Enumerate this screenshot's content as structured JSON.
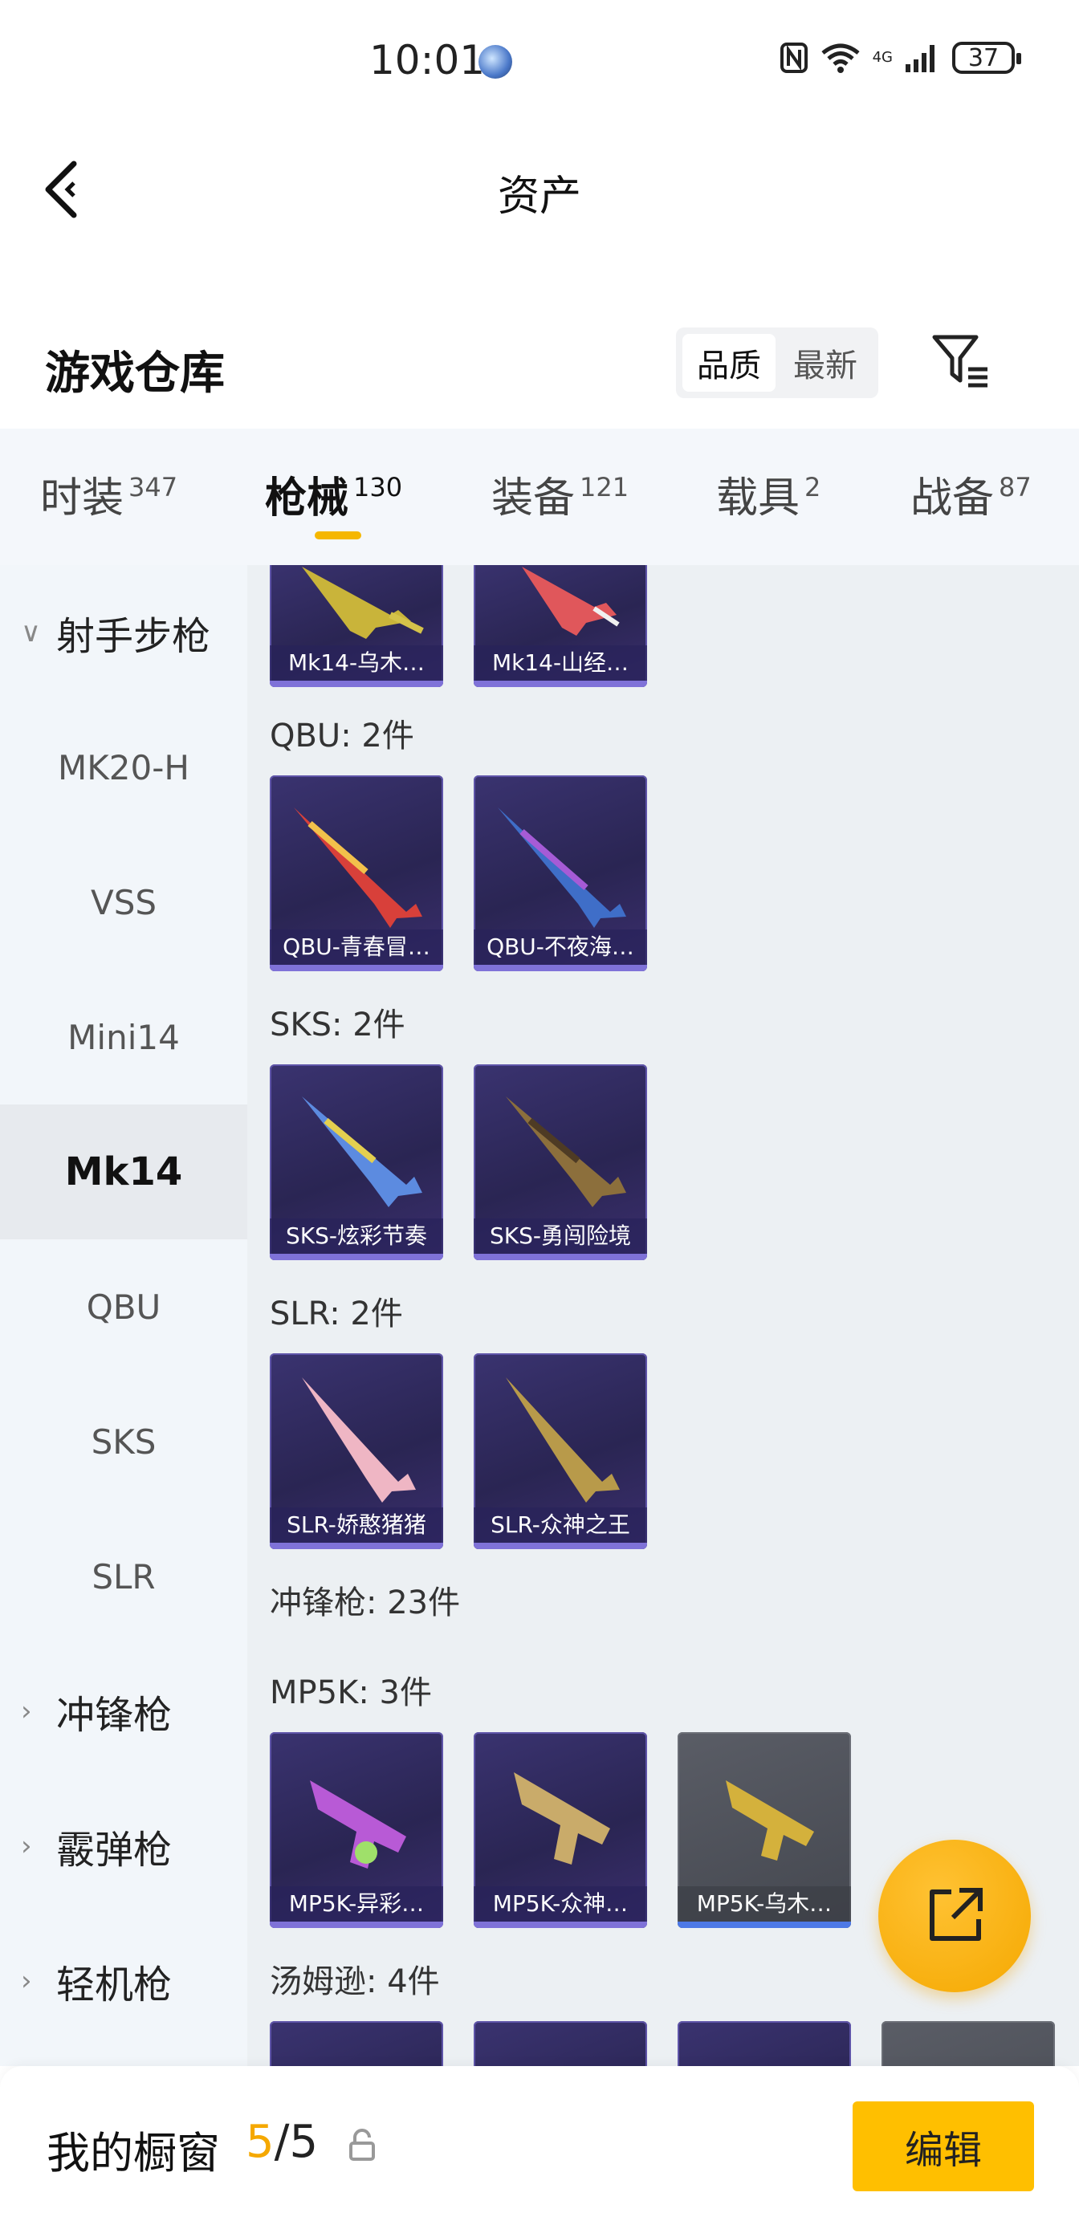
{
  "status_bar": {
    "time": "10:01",
    "network_label": "4G",
    "battery": "37"
  },
  "title_bar": {
    "title": "资产"
  },
  "header": {
    "section_title": "游戏仓库",
    "sort_options": [
      "品质",
      "最新"
    ],
    "active_sort": "品质"
  },
  "tabs": [
    {
      "label": "时装",
      "count": "347"
    },
    {
      "label": "枪械",
      "count": "130"
    },
    {
      "label": "装备",
      "count": "121"
    },
    {
      "label": "载具",
      "count": "2"
    },
    {
      "label": "战备",
      "count": "87"
    }
  ],
  "active_tab": "枪械",
  "sidebar": {
    "groups": [
      {
        "label": "射手步枪",
        "expanded": true
      },
      {
        "label": "冲锋枪",
        "expanded": false
      },
      {
        "label": "霰弹枪",
        "expanded": false
      },
      {
        "label": "轻机枪",
        "expanded": false
      }
    ],
    "items": [
      "MK20-H",
      "VSS",
      "Mini14",
      "Mk14",
      "QBU",
      "SKS",
      "SLR"
    ],
    "selected_item": "Mk14"
  },
  "content": {
    "mk14_cards": [
      "Mk14-乌木…",
      "Mk14-山经…"
    ],
    "groups": [
      {
        "label": "QBU: 2件",
        "cards": [
          "QBU-青春冒…",
          "QBU-不夜海…"
        ]
      },
      {
        "label": "SKS: 2件",
        "cards": [
          "SKS-炫彩节奏",
          "SKS-勇闯险境"
        ]
      },
      {
        "label": "SLR: 2件",
        "cards": [
          "SLR-娇憨猪猪",
          "SLR-众神之王"
        ]
      },
      {
        "label": "MP5K: 3件",
        "cards": [
          "MP5K-异彩…",
          "MP5K-众神…",
          "MP5K-乌木…"
        ]
      }
    ],
    "category_label": "冲锋枪: 23件",
    "thompson_label": "汤姆逊: 4件"
  },
  "bottom_bar": {
    "showcase_label": "我的橱窗",
    "showcase_current": "5",
    "showcase_total": "/5",
    "edit_label": "编辑"
  },
  "colors": {
    "accent": "#f5a800",
    "card_purple": "#2a2553",
    "card_grey": "#4a4d55"
  }
}
